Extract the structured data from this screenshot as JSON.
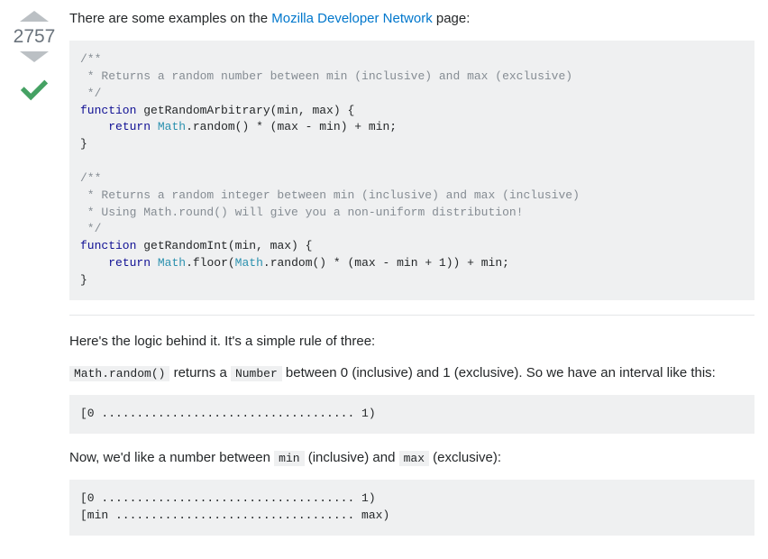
{
  "vote": {
    "score": "2757"
  },
  "intro": {
    "pre": "There are some examples on the ",
    "link": "Mozilla Developer Network",
    "post": " page:"
  },
  "code1": {
    "c1a": "/**",
    "c1b": " * Returns a random number between min (inclusive) and max (exclusive)",
    "c1c": " */",
    "kw_fn1": "function",
    "fname1": " getRandomArbitrary(min, max) {",
    "kw_ret1": "return",
    "math1": "Math",
    "rest1": ".random() * (max - min) + min;",
    "close1": "}",
    "c2a": "/**",
    "c2b": " * Returns a random integer between min (inclusive) and max (inclusive)",
    "c2c": " * Using Math.round() will give you a non-uniform distribution!",
    "c2d": " */",
    "kw_fn2": "function",
    "fname2": " getRandomInt(min, max) {",
    "kw_ret2": "return",
    "math2a": "Math",
    "mid2": ".floor(",
    "math2b": "Math",
    "rest2": ".random() * (max - min + 1)) + min;",
    "close2": "}"
  },
  "logic_intro": "Here's the logic behind it. It's a simple rule of three:",
  "p2": {
    "code_a": "Math.random()",
    "txt_a": " returns a ",
    "code_b": "Number",
    "txt_b": " between 0 (inclusive) and 1 (exclusive). So we have an interval like this:"
  },
  "interval1": "[0 .................................... 1)",
  "p3": {
    "txt_a": "Now, we'd like a number between ",
    "code_a": "min",
    "txt_b": " (inclusive) and ",
    "code_b": "max",
    "txt_c": " (exclusive):"
  },
  "interval2": "[0 .................................... 1)\n[min .................................. max)"
}
